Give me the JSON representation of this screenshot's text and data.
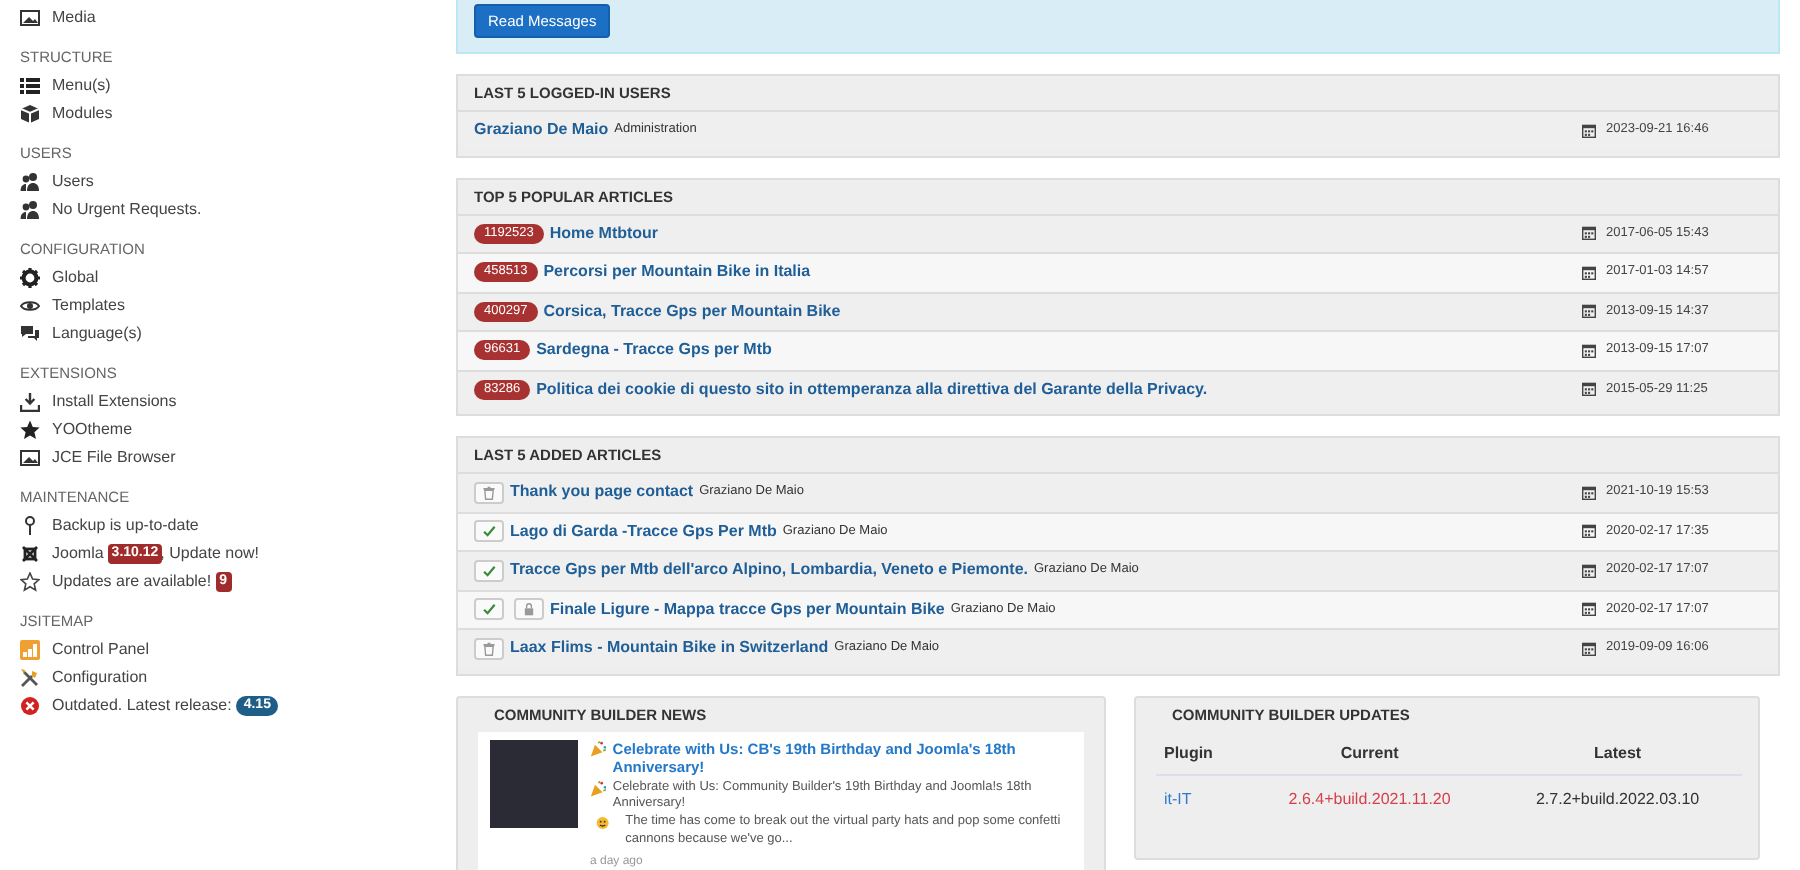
{
  "sidebar": [
    {
      "items": [
        {
          "label": "Media"
        }
      ]
    },
    {
      "title": "STRUCTURE",
      "items": [
        {
          "label": "Menu(s)"
        },
        {
          "label": "Modules"
        }
      ]
    },
    {
      "title": "USERS",
      "items": [
        {
          "label": "Users"
        },
        {
          "label": "No Urgent Requests."
        }
      ]
    },
    {
      "title": "CONFIGURATION",
      "items": [
        {
          "label": "Global"
        },
        {
          "label": "Templates"
        },
        {
          "label": "Language(s)"
        }
      ]
    },
    {
      "title": "EXTENSIONS",
      "items": [
        {
          "label": "Install Extensions"
        },
        {
          "label": "YOOtheme"
        },
        {
          "label": "JCE File Browser"
        }
      ]
    },
    {
      "title": "MAINTENANCE",
      "items": [
        {
          "label": "Backup is up-to-date"
        },
        {
          "label": "Joomla",
          "badge": {
            "text": "3.10.12",
            "kind": "danger"
          },
          "after": ", Update now!"
        },
        {
          "label": "Updates are available!",
          "badge": {
            "text": "9",
            "kind": "danger"
          }
        }
      ]
    },
    {
      "title": "JSITEMAP",
      "items": [
        {
          "label": "Control Panel"
        },
        {
          "label": "Configuration"
        },
        {
          "label": "Outdated. Latest release:",
          "badge": {
            "text": "4.15",
            "kind": "info"
          }
        }
      ]
    }
  ],
  "messages_button": "Read Messages",
  "logged_in": {
    "title": "LAST 5 LOGGED-IN USERS",
    "rows": [
      {
        "name": "Graziano De Maio",
        "role": "Administration",
        "date": "2023-09-21 16:46"
      }
    ]
  },
  "popular": {
    "title": "TOP 5 POPULAR ARTICLES",
    "rows": [
      {
        "hits": "1192523",
        "title": "Home Mtbtour",
        "date": "2017-06-05 15:43"
      },
      {
        "hits": "458513",
        "title": "Percorsi per Mountain Bike in Italia",
        "date": "2017-01-03 14:57"
      },
      {
        "hits": "400297",
        "title": "Corsica, Tracce Gps per Mountain Bike",
        "date": "2013-09-15 14:37"
      },
      {
        "hits": "96631",
        "title": "Sardegna - Tracce Gps per Mtb",
        "date": "2013-09-15 17:07"
      },
      {
        "hits": "83286",
        "title": "Politica dei cookie di questo sito in ottemperanza alla direttiva del Garante della Privacy.",
        "date": "2015-05-29 11:25"
      }
    ]
  },
  "added": {
    "title": "LAST 5 ADDED ARTICLES",
    "rows": [
      {
        "published": false,
        "locked": false,
        "title": "Thank you page contact",
        "author": "Graziano De Maio",
        "date": "2021-10-19 15:53"
      },
      {
        "published": true,
        "locked": false,
        "title": "Lago di Garda -Tracce Gps Per Mtb",
        "author": "Graziano De Maio",
        "date": "2020-02-17 17:35"
      },
      {
        "published": true,
        "locked": false,
        "title": "Tracce Gps per Mtb dell'arco Alpino, Lombardia, Veneto e Piemonte.",
        "author": "Graziano De Maio",
        "date": "2020-02-17 17:07"
      },
      {
        "published": true,
        "locked": true,
        "title": "Finale Ligure - Mappa tracce Gps per Mountain Bike",
        "author": "Graziano De Maio",
        "date": "2020-02-17 17:07"
      },
      {
        "published": false,
        "locked": false,
        "title": "Laax Flims - Mountain Bike in Switzerland",
        "author": "Graziano De Maio",
        "date": "2019-09-09 16:06"
      }
    ]
  },
  "news": {
    "title": "COMMUNITY BUILDER NEWS",
    "item": {
      "title": "Celebrate with Us: CB's 19th Birthday and Joomla's 18th Anniversary!",
      "intro": "Celebrate with Us: Community Builder's 19th Birthday and Joomla!s 18th Anniversary!",
      "body": "The time has come to break out the virtual party hats and pop some confetti cannons because we've go...",
      "time": "a day ago"
    }
  },
  "updates": {
    "title": "COMMUNITY BUILDER UPDATES",
    "columns": [
      "Plugin",
      "Current",
      "Latest"
    ],
    "rows": [
      {
        "plugin": "it-IT",
        "current": "2.6.4+build.2021.11.20",
        "latest": "2.7.2+build.2022.03.10"
      }
    ]
  }
}
